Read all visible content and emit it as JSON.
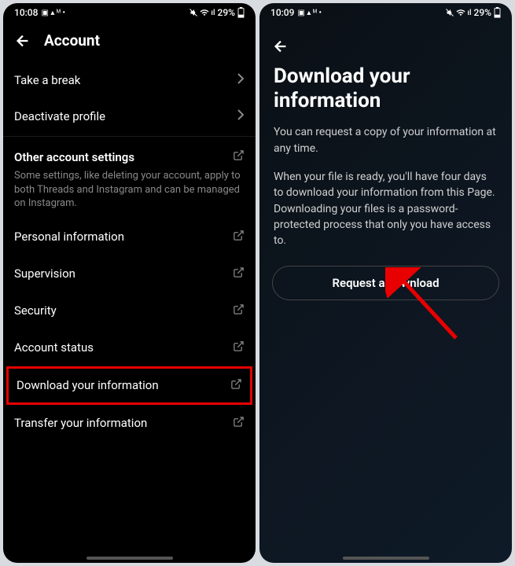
{
  "left": {
    "status": {
      "time": "10:08",
      "battery": "29%"
    },
    "header": {
      "title": "Account"
    },
    "items": [
      {
        "label": "Take a break",
        "type": "chevron"
      },
      {
        "label": "Deactivate profile",
        "type": "chevron"
      }
    ],
    "section": {
      "title": "Other account settings",
      "desc": "Some settings, like deleting your account, apply to both Threads and Instagram and can be managed on Instagram."
    },
    "external_items": [
      {
        "label": "Personal information"
      },
      {
        "label": "Supervision"
      },
      {
        "label": "Security"
      },
      {
        "label": "Account status"
      },
      {
        "label": "Download your information"
      },
      {
        "label": "Transfer your information"
      }
    ]
  },
  "right": {
    "status": {
      "time": "10:09",
      "battery": "29%"
    },
    "title": "Download your information",
    "para1": "You can request a copy of your information at any time.",
    "para2": "When your file is ready, you'll have four days to download your information from this Page. Downloading your files is a password-protected process that only you have access to.",
    "button": "Request a download"
  }
}
